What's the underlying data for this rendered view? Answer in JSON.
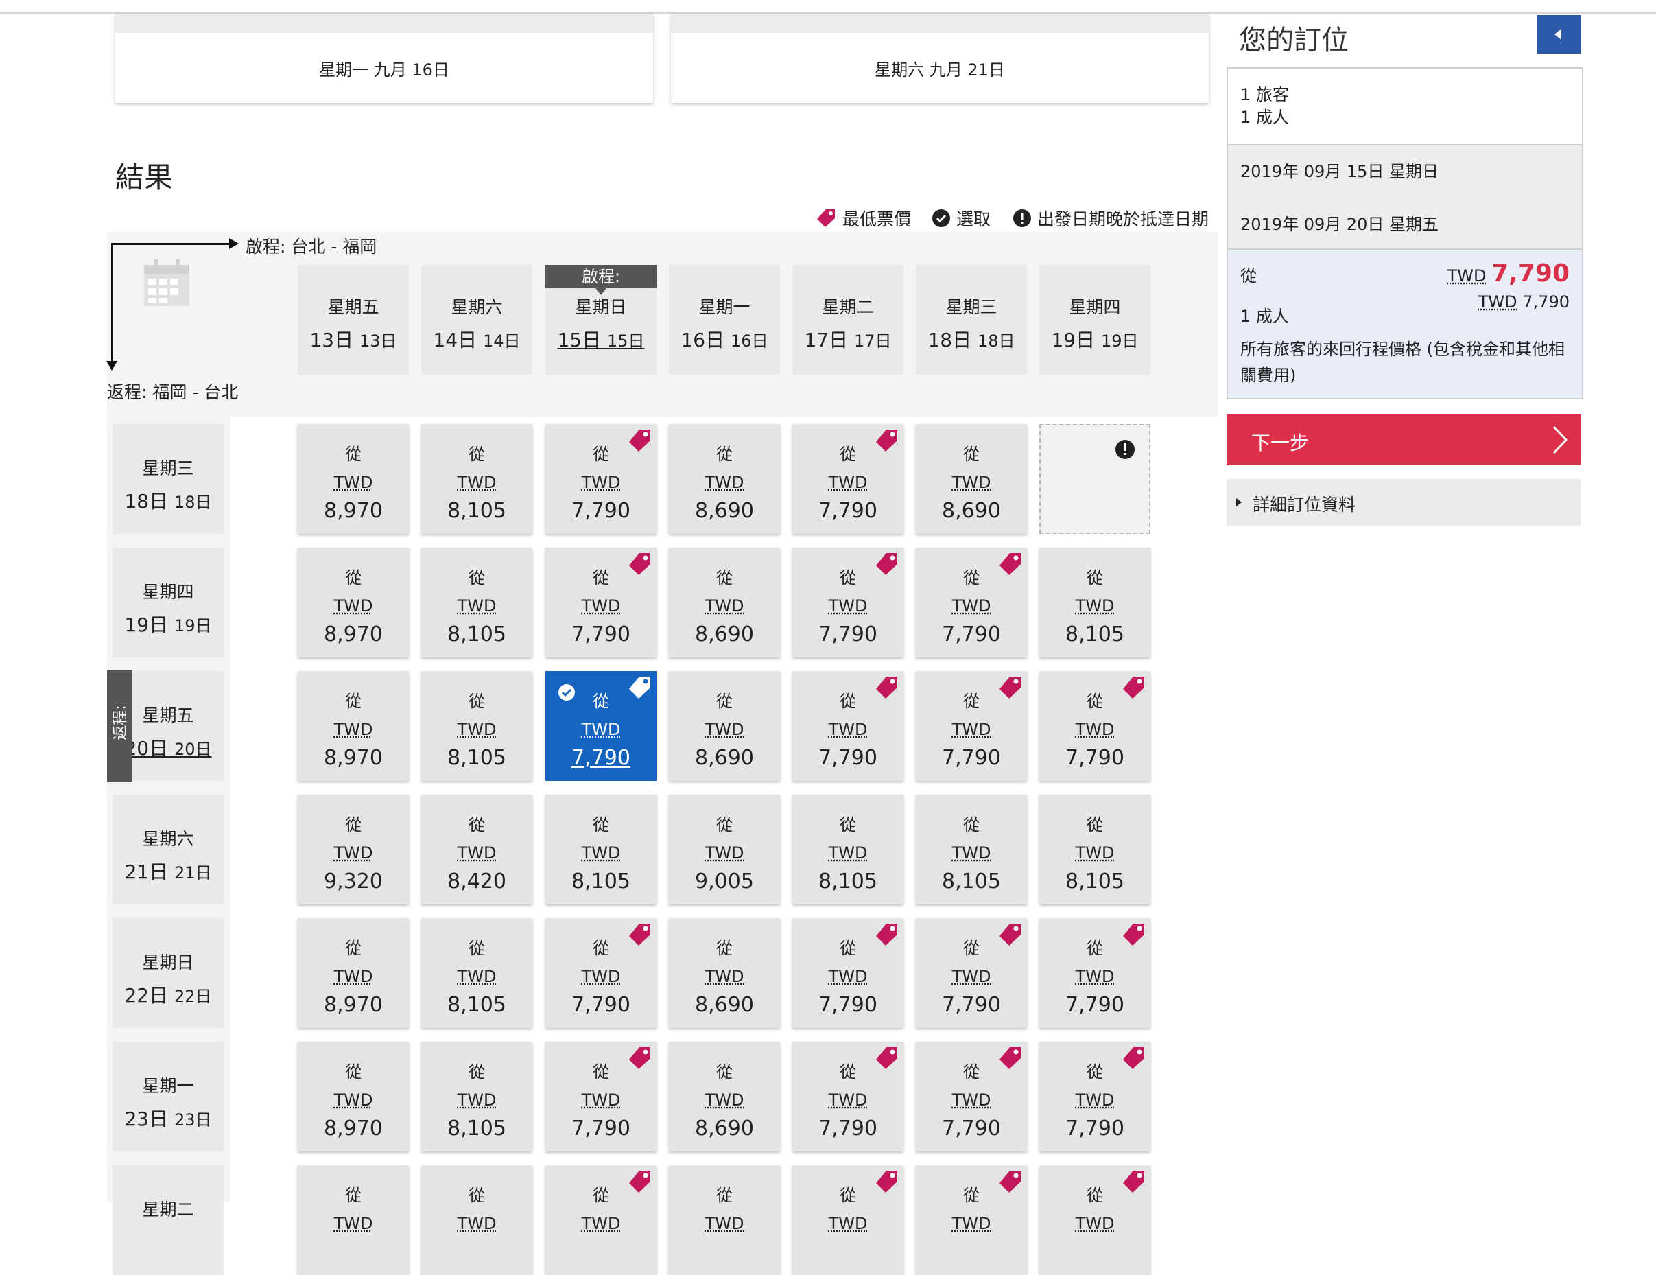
{
  "top_dates": {
    "outbound": "星期一 九月 16日",
    "return": "星期六 九月 21日"
  },
  "results_title": "結果",
  "legend": {
    "lowest": "最低票價",
    "selected": "選取",
    "warning": "出發日期晚於抵達日期"
  },
  "outbound_route_label": "啟程: 台北 - 福岡",
  "return_route_label": "返程: 福岡 - 台北",
  "selected_outbound_tag": "啟程:",
  "selected_return_tag": "返程:",
  "columns": [
    {
      "weekday": "星期五",
      "day": "13日",
      "sub": "13日"
    },
    {
      "weekday": "星期六",
      "day": "14日",
      "sub": "14日"
    },
    {
      "weekday": "星期日",
      "day": "15日",
      "sub": "15日"
    },
    {
      "weekday": "星期一",
      "day": "16日",
      "sub": "16日"
    },
    {
      "weekday": "星期二",
      "day": "17日",
      "sub": "17日"
    },
    {
      "weekday": "星期三",
      "day": "18日",
      "sub": "18日"
    },
    {
      "weekday": "星期四",
      "day": "19日",
      "sub": "19日"
    }
  ],
  "rows": [
    {
      "weekday": "星期三",
      "day": "18日",
      "sub": "18日"
    },
    {
      "weekday": "星期四",
      "day": "19日",
      "sub": "19日"
    },
    {
      "weekday": "星期五",
      "day": "20日",
      "sub": "20日"
    },
    {
      "weekday": "星期六",
      "day": "21日",
      "sub": "21日"
    },
    {
      "weekday": "星期日",
      "day": "22日",
      "sub": "22日"
    },
    {
      "weekday": "星期一",
      "day": "23日",
      "sub": "23日"
    },
    {
      "weekday": "星期二",
      "day": "",
      "sub": ""
    }
  ],
  "cell_from": "從",
  "cell_currency": "TWD",
  "grid": [
    [
      {
        "p": "8,970"
      },
      {
        "p": "8,105"
      },
      {
        "p": "7,790",
        "low": true
      },
      {
        "p": "8,690"
      },
      {
        "p": "7,790",
        "low": true
      },
      {
        "p": "8,690"
      },
      {
        "empty": true
      }
    ],
    [
      {
        "p": "8,970"
      },
      {
        "p": "8,105"
      },
      {
        "p": "7,790",
        "low": true
      },
      {
        "p": "8,690"
      },
      {
        "p": "7,790",
        "low": true
      },
      {
        "p": "7,790",
        "low": true
      },
      {
        "p": "8,105"
      }
    ],
    [
      {
        "p": "8,970"
      },
      {
        "p": "8,105"
      },
      {
        "p": "7,790",
        "low": true,
        "sel": true
      },
      {
        "p": "8,690"
      },
      {
        "p": "7,790",
        "low": true
      },
      {
        "p": "7,790",
        "low": true
      },
      {
        "p": "7,790",
        "low": true
      }
    ],
    [
      {
        "p": "9,320"
      },
      {
        "p": "8,420"
      },
      {
        "p": "8,105"
      },
      {
        "p": "9,005"
      },
      {
        "p": "8,105"
      },
      {
        "p": "8,105"
      },
      {
        "p": "8,105"
      }
    ],
    [
      {
        "p": "8,970"
      },
      {
        "p": "8,105"
      },
      {
        "p": "7,790",
        "low": true
      },
      {
        "p": "8,690"
      },
      {
        "p": "7,790",
        "low": true
      },
      {
        "p": "7,790",
        "low": true
      },
      {
        "p": "7,790",
        "low": true
      }
    ],
    [
      {
        "p": "8,970"
      },
      {
        "p": "8,105"
      },
      {
        "p": "7,790",
        "low": true
      },
      {
        "p": "8,690"
      },
      {
        "p": "7,790",
        "low": true
      },
      {
        "p": "7,790",
        "low": true
      },
      {
        "p": "7,790",
        "low": true
      }
    ],
    [
      {
        "p": ""
      },
      {
        "p": ""
      },
      {
        "p": "",
        "low": true
      },
      {
        "p": ""
      },
      {
        "p": "",
        "low": true
      },
      {
        "p": "",
        "low": true
      },
      {
        "p": "",
        "low": true
      }
    ]
  ],
  "sidebar": {
    "title": "您的訂位",
    "travelers": "1 旅客",
    "adults": "1 成人",
    "outbound_date": "2019年 09月 15日 星期日",
    "return_date": "2019年 09月 20日 星期五",
    "from_label": "從",
    "total_currency": "TWD",
    "total_value": "7,790",
    "adult_label": "1 成人",
    "adult_currency": "TWD",
    "adult_value": "7,790",
    "note": "所有旅客的來回行程價格 (包含稅金和其他相關費用)",
    "next_button": "下一步",
    "details_link": "詳細訂位資料"
  },
  "colors": {
    "accent_red": "#dc2f4a",
    "selected_blue": "#1565c0",
    "tag_red": "#c2185b",
    "collapse_blue": "#2c5aa8"
  }
}
